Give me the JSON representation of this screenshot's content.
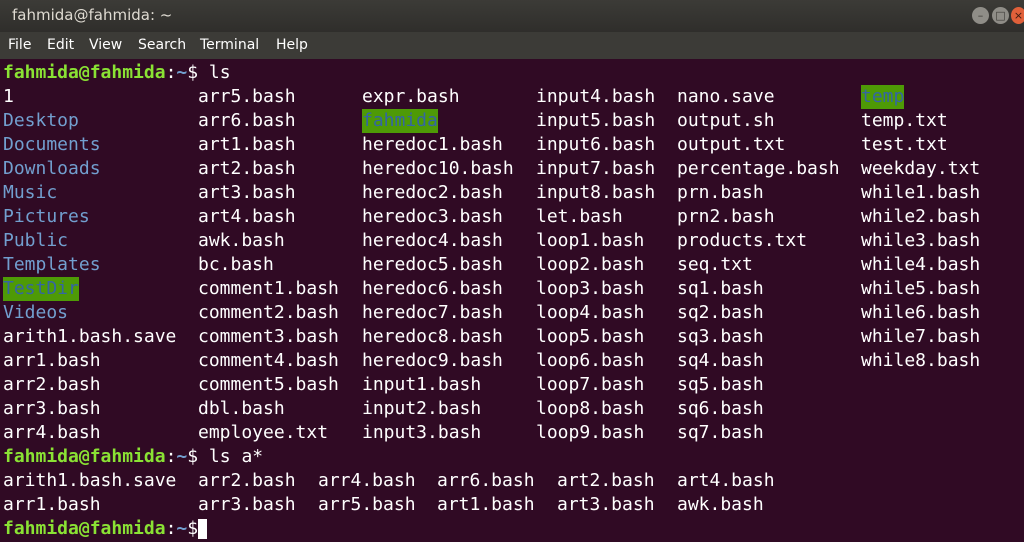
{
  "window": {
    "title": "fahmida@fahmida: ~",
    "buttons": {
      "minimize": "–",
      "maximize": "□",
      "close": "×"
    }
  },
  "menu": [
    "File",
    "Edit",
    "View",
    "Search",
    "Terminal",
    "Help"
  ],
  "prompt": {
    "user": "fahmida@fahmida",
    "path": "~",
    "symbol": "$"
  },
  "colors": {
    "background": "#300a24",
    "prompt_user": "#8ae234",
    "directory": "#729fcf",
    "other_writable_bg": "#4e9a06"
  },
  "commands": [
    " ls",
    " ls a*",
    ""
  ],
  "ls_rows": [
    [
      "1",
      "arr5.bash",
      "expr.bash",
      "input4.bash",
      "nano.save",
      "temp"
    ],
    [
      "Desktop",
      "arr6.bash",
      "fahmida",
      "input5.bash",
      "output.sh",
      "temp.txt"
    ],
    [
      "Documents",
      "art1.bash",
      "heredoc1.bash",
      "input6.bash",
      "output.txt",
      "test.txt"
    ],
    [
      "Downloads",
      "art2.bash",
      "heredoc10.bash",
      "input7.bash",
      "percentage.bash",
      "weekday.txt"
    ],
    [
      "Music",
      "art3.bash",
      "heredoc2.bash",
      "input8.bash",
      "prn.bash",
      "while1.bash"
    ],
    [
      "Pictures",
      "art4.bash",
      "heredoc3.bash",
      "let.bash",
      "prn2.bash",
      "while2.bash"
    ],
    [
      "Public",
      "awk.bash",
      "heredoc4.bash",
      "loop1.bash",
      "products.txt",
      "while3.bash"
    ],
    [
      "Templates",
      "bc.bash",
      "heredoc5.bash",
      "loop2.bash",
      "seq.txt",
      "while4.bash"
    ],
    [
      "TestDir",
      "comment1.bash",
      "heredoc6.bash",
      "loop3.bash",
      "sq1.bash",
      "while5.bash"
    ],
    [
      "Videos",
      "comment2.bash",
      "heredoc7.bash",
      "loop4.bash",
      "sq2.bash",
      "while6.bash"
    ],
    [
      "arith1.bash.save",
      "comment3.bash",
      "heredoc8.bash",
      "loop5.bash",
      "sq3.bash",
      "while7.bash"
    ],
    [
      "arr1.bash",
      "comment4.bash",
      "heredoc9.bash",
      "loop6.bash",
      "sq4.bash",
      "while8.bash"
    ],
    [
      "arr2.bash",
      "comment5.bash",
      "input1.bash",
      "loop7.bash",
      "sq5.bash",
      ""
    ],
    [
      "arr3.bash",
      "dbl.bash",
      "input2.bash",
      "loop8.bash",
      "sq6.bash",
      ""
    ],
    [
      "arr4.bash",
      "employee.txt",
      "input3.bash",
      "loop9.bash",
      "sq7.bash",
      ""
    ]
  ],
  "ls_a_rows": [
    [
      "arith1.bash.save",
      "arr2.bash",
      "arr4.bash",
      "arr6.bash",
      "art2.bash",
      "art4.bash"
    ],
    [
      "arr1.bash",
      "arr3.bash",
      "arr5.bash",
      "art1.bash",
      "art3.bash",
      "awk.bash"
    ]
  ],
  "directories": [
    "Desktop",
    "Documents",
    "Downloads",
    "Music",
    "Pictures",
    "Public",
    "Templates",
    "Videos"
  ],
  "other_writable_dirs": [
    "temp",
    "fahmida",
    "TestDir"
  ]
}
